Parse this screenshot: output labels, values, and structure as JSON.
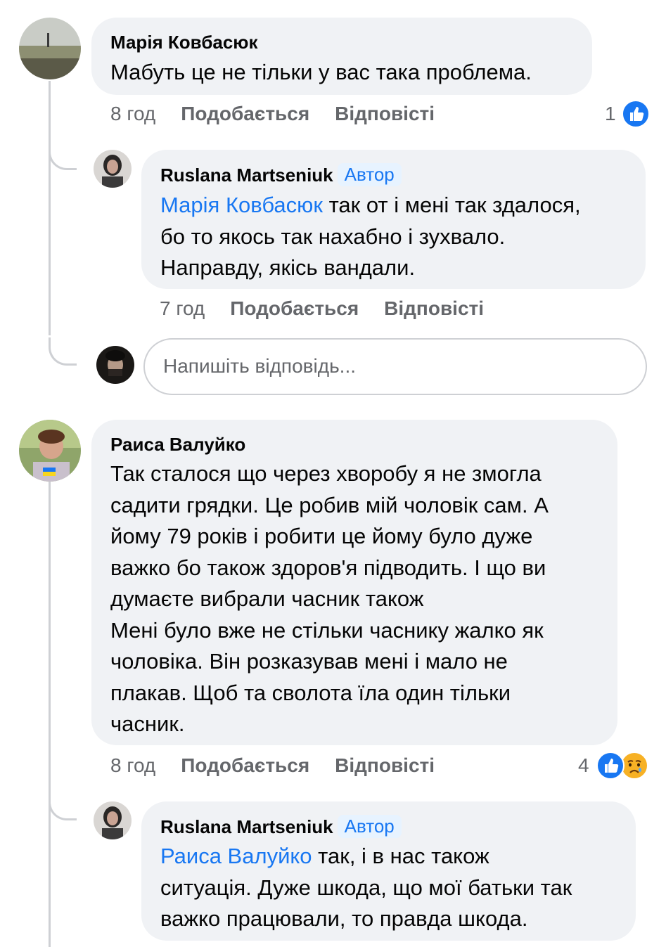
{
  "comments": [
    {
      "author": "Марія Ковбасюк",
      "text": "Мабуть це не тільки у вас така проблема.",
      "time": "8 год",
      "like_label": "Подобається",
      "reply_label": "Відповісті",
      "reaction_count": "1",
      "reactions": [
        "like"
      ]
    },
    {
      "author": "Ruslana Martseniuk",
      "badge": "Автор",
      "mention": "Марія Ковбасюк",
      "text_after_mention": " так от і мені так здалося,",
      "lines": [
        "бо то якось так нахабно і зухвало.",
        "Направду, якісь вандали."
      ],
      "time": "7 год",
      "like_label": "Подобається",
      "reply_label": "Відповісті"
    },
    {
      "author": "Раиса Валуйко",
      "lines": [
        "Так сталося що через хворобу я не змогла",
        "садити грядки. Це робив мій чоловік сам. А",
        "йому 79 років і робити це йому було дуже",
        "важко бо також здоров'я підводить. І що ви",
        "думаєте вибрали часник також",
        "Мені було вже не стільки часнику жалко як",
        "чоловіка. Він розказував мені і мало не",
        "плакав. Щоб та сволота їла один тільки",
        "часник."
      ],
      "time": "8 год",
      "like_label": "Подобається",
      "reply_label": "Відповісті",
      "reaction_count": "4",
      "reactions": [
        "like",
        "sad"
      ]
    },
    {
      "author": "Ruslana Martseniuk",
      "badge": "Автор",
      "mention": "Раиса Валуйко",
      "text_after_mention": " так, і в нас також",
      "lines": [
        "ситуація. Дуже шкода, що мої батьки так",
        "важко працювали, то правда шкода."
      ]
    }
  ],
  "reply_input": {
    "placeholder": "Напишіть відповідь..."
  },
  "colors": {
    "bubble": "#f0f2f5",
    "mention": "#1877f2",
    "meta": "#65676b",
    "badge_bg": "#e7f3ff"
  }
}
